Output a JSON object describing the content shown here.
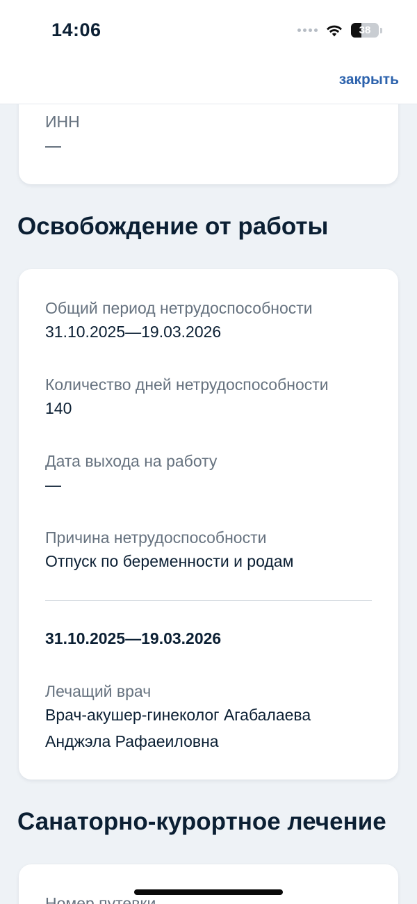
{
  "status_bar": {
    "time": "14:06",
    "battery": "38",
    "battery_level": 0.38
  },
  "header": {
    "close_label": "закрыть"
  },
  "inn_card": {
    "label": "ИНН",
    "value": "—"
  },
  "work_release": {
    "title": "Освобождение от работы",
    "total_period_label": "Общий период нетрудоспособности",
    "total_period_value": "31.10.2025—19.03.2026",
    "days_label": "Количество дней нетрудоспособности",
    "days_value": "140",
    "return_date_label": "Дата выхода на работу",
    "return_date_value": "—",
    "reason_label": "Причина нетрудоспособности",
    "reason_value": "Отпуск по беременности и родам",
    "period_heading": "31.10.2025—19.03.2026",
    "doctor_label": "Лечащий врач",
    "doctor_value_line1": "Врач-акушер-гинеколог Агабалаева",
    "doctor_value_line2": "Анджэла Рафаеиловна"
  },
  "sanatorium": {
    "title": "Санаторно-курортное лечение",
    "voucher_label": "Номер путевки"
  },
  "colors": {
    "accent": "#2d63ad",
    "text": "#0b1f33",
    "muted": "#66727f",
    "background": "#eef2f6"
  }
}
